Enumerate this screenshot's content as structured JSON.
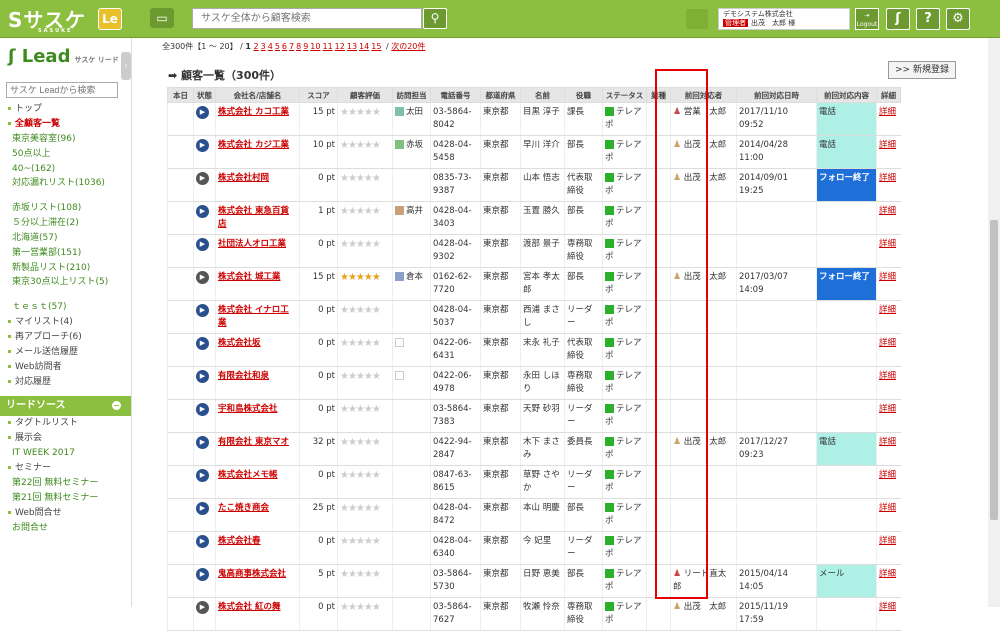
{
  "header": {
    "logo": "Sサスケ",
    "logo_sub": "SASUKE",
    "le_label": "Le",
    "search_placeholder": "サスケ全体から顧客検索",
    "company": "デモシステム株式会社",
    "role_tag": "管理者",
    "user": "出茂　太郎 様",
    "logout": "Logout"
  },
  "sidebar": {
    "title": "Lead",
    "title_sub": "サスケ リード",
    "search_placeholder": "サスケ Leadから検索",
    "items": [
      {
        "label": "トップ",
        "type": "main"
      },
      {
        "label": "全顧客一覧",
        "type": "main",
        "active": true
      },
      {
        "label": "東京美容室(96)",
        "type": "sub"
      },
      {
        "label": "50点以上",
        "type": "sub"
      },
      {
        "label": "40~(162)",
        "type": "sub"
      },
      {
        "label": "対応漏れリスト(1036)",
        "type": "sub",
        "wrap": true
      },
      {
        "label": "赤坂リスト(108)",
        "type": "sub"
      },
      {
        "label": "５分以上滞在(2)",
        "type": "sub"
      },
      {
        "label": "北海道(57)",
        "type": "sub"
      },
      {
        "label": "第一営業部(151)",
        "type": "sub"
      },
      {
        "label": "新製品リスト(210)",
        "type": "sub"
      },
      {
        "label": "東京30点以上リスト(5)",
        "type": "sub",
        "wrap": true
      },
      {
        "label": "ｔｅｓｔ(57)",
        "type": "sub"
      },
      {
        "label": "マイリスト(4)",
        "type": "main"
      },
      {
        "label": "再アプローチ(6)",
        "type": "main"
      },
      {
        "label": "メール送信履歴",
        "type": "main"
      },
      {
        "label": "Web訪問者",
        "type": "main"
      },
      {
        "label": "対応履歴",
        "type": "main"
      }
    ],
    "lead_source": "リードソース",
    "source_items": [
      {
        "label": "タグトルリスト",
        "type": "main"
      },
      {
        "label": "展示会",
        "type": "main"
      },
      {
        "label": "IT WEEK 2017",
        "type": "sub"
      },
      {
        "label": "セミナー",
        "type": "main"
      },
      {
        "label": "第22回 無料セミナー",
        "type": "sub"
      },
      {
        "label": "第21回 無料セミナー",
        "type": "sub"
      },
      {
        "label": "Web問合せ",
        "type": "main"
      },
      {
        "label": "お問合せ",
        "type": "sub"
      }
    ]
  },
  "pager": {
    "summary": "全300件【1 ～ 20】 /",
    "current": "1",
    "pages": [
      "2",
      "3",
      "4",
      "5",
      "6",
      "7",
      "8",
      "9",
      "10",
      "11",
      "12",
      "13",
      "14",
      "15"
    ],
    "next": "次の20件"
  },
  "list": {
    "title": "顧客一覧（300件）",
    "new_button": ">> 新規登録",
    "columns": [
      "本日",
      "状態",
      "会社名/店舗名",
      "スコア",
      "顧客評価",
      "訪問担当",
      "電話番号",
      "都道府県",
      "名前",
      "役職",
      "ステータス",
      "業種",
      "前回対応者",
      "前回対応日時",
      "前回対応内容",
      "詳細"
    ],
    "rows": [
      {
        "company": "株式会社 カコ工業",
        "score": "15 pt",
        "stars": 0,
        "visit": "太田",
        "vcolor": "#7fbfb0",
        "phone": "03-5864-8042",
        "pref": "東京都",
        "name": "目黒 淳子",
        "title": "課長",
        "status": "テレアポ",
        "person": "営業　太郎",
        "pcolor": "#c44",
        "date": "2017/11/10 09:52",
        "content": "電話",
        "ctype": "cy",
        "state": "blue"
      },
      {
        "company": "株式会社 カジ工業",
        "score": "10 pt",
        "stars": 0,
        "visit": "赤坂",
        "vcolor": "#7fbf7f",
        "phone": "0428-04-5458",
        "pref": "東京都",
        "name": "早川 洋介",
        "title": "部長",
        "status": "テレアポ",
        "person": "出茂　太郎",
        "pcolor": "#c9a36a",
        "date": "2014/04/28 11:00",
        "content": "電話",
        "ctype": "cy",
        "state": "blue"
      },
      {
        "company": "株式会社村岡",
        "score": "0 pt",
        "stars": 0,
        "visit": "",
        "vcolor": "",
        "phone": "0835-73-9387",
        "pref": "東京都",
        "name": "山本 悟志",
        "title": "代表取締役",
        "status": "テレアポ",
        "person": "出茂　太郎",
        "pcolor": "#c9a36a",
        "date": "2014/09/01 19:25",
        "content": "フォロー終了",
        "ctype": "bl",
        "state": "gray"
      },
      {
        "company": "株式会社 東急百貨店",
        "score": "1 pt",
        "stars": 0,
        "visit": "高井",
        "vcolor": "#c9a07a",
        "phone": "0428-04-3403",
        "pref": "東京都",
        "name": "玉置 勝久",
        "title": "部長",
        "status": "テレアポ",
        "person": "",
        "pcolor": "",
        "date": "",
        "content": "",
        "ctype": "",
        "state": "blue"
      },
      {
        "company": "社団法人オロ工業",
        "score": "0 pt",
        "stars": 0,
        "visit": "",
        "vcolor": "",
        "phone": "0428-04-9302",
        "pref": "東京都",
        "name": "渡部 景子",
        "title": "専務取締役",
        "status": "テレアポ",
        "person": "",
        "pcolor": "",
        "date": "",
        "content": "",
        "ctype": "",
        "state": "blue"
      },
      {
        "company": "株式会社 城工業",
        "score": "15 pt",
        "stars": 5,
        "visit": "倉本",
        "vcolor": "#8aa0c8",
        "phone": "0162-62-7720",
        "pref": "東京都",
        "name": "宮本 孝太郎",
        "title": "部長",
        "status": "テレアポ",
        "person": "出茂　太郎",
        "pcolor": "#c9a36a",
        "date": "2017/03/07 14:09",
        "content": "フォロー終了",
        "ctype": "bl",
        "state": "gray"
      },
      {
        "company": "株式会社 イナロ工業",
        "score": "0 pt",
        "stars": 0,
        "visit": "",
        "vcolor": "",
        "phone": "0428-04-5037",
        "pref": "東京都",
        "name": "西浦 まさし",
        "title": "リーダー",
        "status": "テレアポ",
        "person": "",
        "pcolor": "",
        "date": "",
        "content": "",
        "ctype": "",
        "state": "blue"
      },
      {
        "company": "株式会社坂",
        "score": "0 pt",
        "stars": 0,
        "visit": "",
        "vcolor": "empty",
        "phone": "0422-06-6431",
        "pref": "東京都",
        "name": "末永 礼子",
        "title": "代表取締役",
        "status": "テレアポ",
        "person": "",
        "pcolor": "",
        "date": "",
        "content": "",
        "ctype": "",
        "state": "blue"
      },
      {
        "company": "有限会社和泉",
        "score": "0 pt",
        "stars": 0,
        "visit": "",
        "vcolor": "empty",
        "phone": "0422-06-4978",
        "pref": "東京都",
        "name": "永田 しほり",
        "title": "専務取締役",
        "status": "テレアポ",
        "person": "",
        "pcolor": "",
        "date": "",
        "content": "",
        "ctype": "",
        "state": "blue"
      },
      {
        "company": "宇和島株式会社",
        "score": "0 pt",
        "stars": 0,
        "visit": "",
        "vcolor": "",
        "phone": "03-5864-7383",
        "pref": "東京都",
        "name": "天野 砂羽",
        "title": "リーダー",
        "status": "テレアポ",
        "person": "",
        "pcolor": "",
        "date": "",
        "content": "",
        "ctype": "",
        "state": "blue"
      },
      {
        "company": "有限会社 東京マオ",
        "score": "32 pt",
        "stars": 0,
        "visit": "",
        "vcolor": "",
        "phone": "0422-94-2847",
        "pref": "東京都",
        "name": "木下 まさみ",
        "title": "委員長",
        "status": "テレアポ",
        "person": "出茂　太郎",
        "pcolor": "#c9a36a",
        "date": "2017/12/27 09:23",
        "content": "電話",
        "ctype": "cy",
        "state": "blue"
      },
      {
        "company": "株式会社メモ帳",
        "score": "0 pt",
        "stars": 0,
        "visit": "",
        "vcolor": "",
        "phone": "0847-63-8615",
        "pref": "東京都",
        "name": "草野 さやか",
        "title": "リーダー",
        "status": "テレアポ",
        "person": "",
        "pcolor": "",
        "date": "",
        "content": "",
        "ctype": "",
        "state": "blue"
      },
      {
        "company": "たこ焼き商会",
        "score": "25 pt",
        "stars": 0,
        "visit": "",
        "vcolor": "",
        "phone": "0428-04-8472",
        "pref": "東京都",
        "name": "本山 明慶",
        "title": "部長",
        "status": "テレアポ",
        "person": "",
        "pcolor": "",
        "date": "",
        "content": "",
        "ctype": "",
        "state": "blue"
      },
      {
        "company": "株式会社春",
        "score": "0 pt",
        "stars": 0,
        "visit": "",
        "vcolor": "",
        "phone": "0428-04-6340",
        "pref": "東京都",
        "name": "今 妃里",
        "title": "リーダー",
        "status": "テレアポ",
        "person": "",
        "pcolor": "",
        "date": "",
        "content": "",
        "ctype": "",
        "state": "blue"
      },
      {
        "company": "鬼高商事株式会社",
        "score": "5 pt",
        "stars": 0,
        "visit": "",
        "vcolor": "",
        "phone": "03-5864-5730",
        "pref": "東京都",
        "name": "日野 恵美",
        "title": "部長",
        "status": "テレアポ",
        "person": "リード直太郎",
        "pcolor": "#c44",
        "date": "2015/04/14 14:05",
        "content": "メール",
        "ctype": "cy",
        "state": "blue"
      },
      {
        "company": "株式会社 紅の舞",
        "score": "0 pt",
        "stars": 0,
        "visit": "",
        "vcolor": "",
        "phone": "03-5864-7627",
        "pref": "東京都",
        "name": "牧瀬 怜奈",
        "title": "専務取締役",
        "status": "テレアポ",
        "person": "出茂　太郎",
        "pcolor": "#c9a36a",
        "date": "2015/11/19 17:59",
        "content": "",
        "ctype": "",
        "state": "gray"
      }
    ],
    "detail": "詳細"
  }
}
